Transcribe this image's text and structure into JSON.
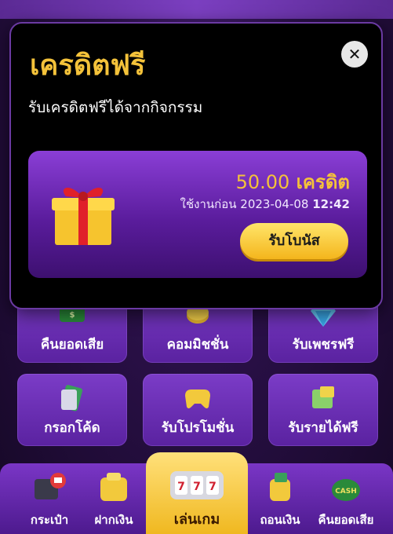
{
  "modal": {
    "title": "เครดิตฟรี",
    "close_icon": "close-icon",
    "subtitle": "รับเครดิตฟรีได้จากกิจกรรม",
    "reward": {
      "amount": "50.00",
      "unit": "เครดิต",
      "expiry_prefix": "ใช้งานก่อน",
      "expiry_date": "2023-04-08",
      "expiry_time": "12:42",
      "claim_label": "รับโบนัส",
      "gift_icon": "gift-box-icon"
    }
  },
  "menu_tiles": [
    {
      "label": "คืนยอดเสีย",
      "icon": "cashback-icon"
    },
    {
      "label": "คอมมิชชั่น",
      "icon": "coins-icon"
    },
    {
      "label": "รับเพชรฟรี",
      "icon": "diamond-icon"
    },
    {
      "label": "กรอกโค้ด",
      "icon": "code-card-icon"
    },
    {
      "label": "รับโปรโมชั่น",
      "icon": "gamepad-icon"
    },
    {
      "label": "รับรายได้ฟรี",
      "icon": "money-card-icon"
    }
  ],
  "bottom_nav": [
    {
      "label": "กระเป๋า",
      "icon": "wallet-icon"
    },
    {
      "label": "ฝากเงิน",
      "icon": "deposit-icon"
    },
    {
      "label": "เล่นเกม",
      "icon": "slot-machine-icon"
    },
    {
      "label": "ถอนเงิน",
      "icon": "withdraw-icon"
    },
    {
      "label": "คืนยอดเสีย",
      "icon": "cashback-icon"
    }
  ],
  "colors": {
    "accent_gold": "#f4c23a",
    "card_purple": "#8a3ed6",
    "modal_bg": "#000000"
  }
}
